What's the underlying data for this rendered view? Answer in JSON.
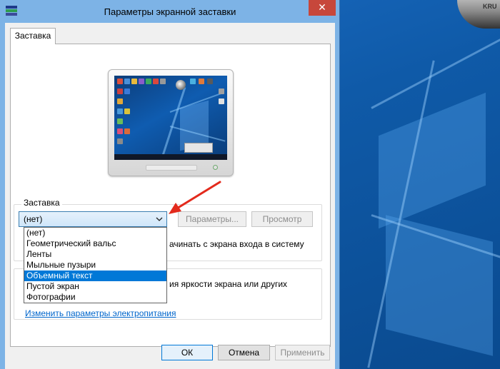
{
  "window": {
    "title": "Параметры экранной заставки",
    "close_glyph": "✕"
  },
  "tabs": [
    {
      "label": "Заставка"
    }
  ],
  "screensaver": {
    "group_label": "Заставка",
    "selected_value": "(нет)",
    "params_label": "Параметры...",
    "preview_label": "Просмотр",
    "options": [
      "(нет)",
      "Геометрический вальс",
      "Ленты",
      "Мыльные пузыри",
      "Объемный текст",
      "Пустой экран",
      "Фотографии"
    ],
    "highlighted_index": 4,
    "login_text_partial": "ачинать с экрана входа в систему"
  },
  "power": {
    "description_partial": "ия яркости экрана или других",
    "link_label": "Изменить параметры электропитания"
  },
  "footer": {
    "ok_label": "ОК",
    "cancel_label": "Отмена",
    "apply_label": "Применить"
  },
  "desktop": {
    "device_text": "KRU"
  },
  "colors": {
    "accent": "#0078d7",
    "close": "#c7473b",
    "annotation": "#e32a1c",
    "titlebar": "#7db3e6"
  },
  "icons": {
    "window": "screensaver-window-icon",
    "dropdown": "chevron-down-icon",
    "annotation": "red-arrow-icon"
  }
}
